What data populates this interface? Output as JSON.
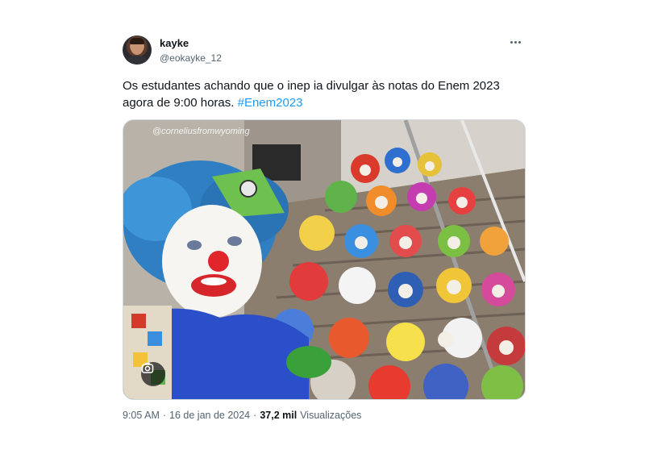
{
  "tweet": {
    "display_name": "kayke",
    "handle": "@eokayke_12",
    "text": "Os estudantes achando que o inep ia divulgar às notas do Enem 2023 agora de 9:00 horas.",
    "hashtag": "#Enem2023",
    "media": {
      "watermark": "@corneliusfromwyoming",
      "lens_icon": "lens-search-icon"
    },
    "time": "9:05 AM",
    "separator": "·",
    "date": "16 de jan de 2024",
    "views_count": "37,2 mil",
    "views_label": "Visualizações"
  },
  "colors": {
    "accent": "#1d9bf0",
    "text": "#0f1419",
    "muted": "#536471",
    "border": "#cfd9de"
  }
}
